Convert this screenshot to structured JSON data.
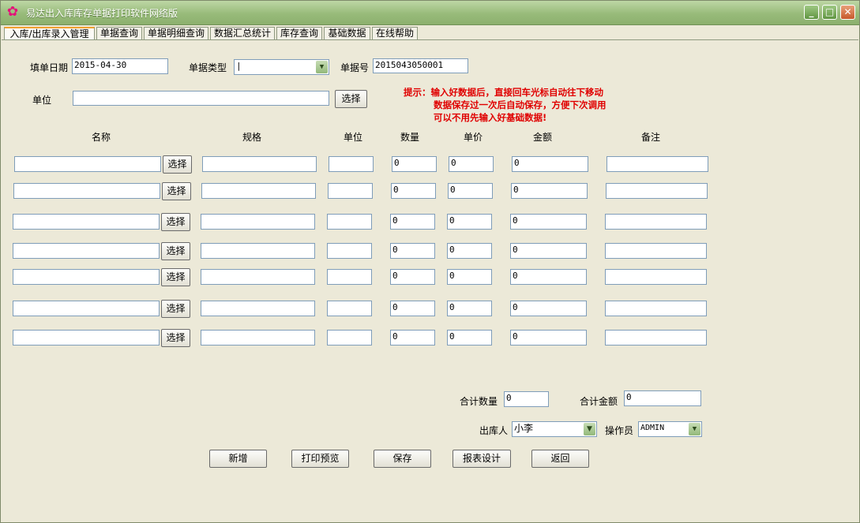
{
  "window": {
    "title": "易达出入库库存单据打印软件网络版",
    "app_icon": "flower-icon"
  },
  "tabs": [
    "入库/出库录入管理",
    "单据查询",
    "单据明细查询",
    "数据汇总统计",
    "库存查询",
    "基础数据",
    "在线帮助"
  ],
  "form": {
    "date_label": "填单日期",
    "date_value": "2015-04-30",
    "type_label": "单据类型",
    "type_value": "|",
    "no_label": "单据号",
    "no_value": "2015043050001",
    "unit_label": "单位",
    "unit_value": "",
    "select_label": "选择"
  },
  "hint": [
    "提示：输入好数据后，直接回车光标自动往下移动",
    "数据保存过一次后自动保存，方便下次调用",
    "可以不用先输入好基础数据!"
  ],
  "columns": [
    "名称",
    "规格",
    "单位",
    "数量",
    "单价",
    "金额",
    "备注"
  ],
  "row_button_label": "选择",
  "rows": [
    {
      "name": "",
      "spec": "",
      "unit": "",
      "qty": "0",
      "price": "0",
      "amount": "0",
      "note": ""
    },
    {
      "name": "",
      "spec": "",
      "unit": "",
      "qty": "0",
      "price": "0",
      "amount": "0",
      "note": ""
    },
    {
      "name": "",
      "spec": "",
      "unit": "",
      "qty": "0",
      "price": "0",
      "amount": "0",
      "note": ""
    },
    {
      "name": "",
      "spec": "",
      "unit": "",
      "qty": "0",
      "price": "0",
      "amount": "0",
      "note": ""
    },
    {
      "name": "",
      "spec": "",
      "unit": "",
      "qty": "0",
      "price": "0",
      "amount": "0",
      "note": ""
    },
    {
      "name": "",
      "spec": "",
      "unit": "",
      "qty": "0",
      "price": "0",
      "amount": "0",
      "note": ""
    },
    {
      "name": "",
      "spec": "",
      "unit": "",
      "qty": "0",
      "price": "0",
      "amount": "0",
      "note": ""
    }
  ],
  "totals": {
    "qty_label": "合计数量",
    "qty_value": "0",
    "amount_label": "合计金额",
    "amount_value": "0"
  },
  "people": {
    "out_label": "出库人",
    "out_value": "小李",
    "op_label": "操作员",
    "op_value": "ADMIN"
  },
  "actions": [
    "新增",
    "打印预览",
    "保存",
    "报表设计",
    "返回"
  ]
}
